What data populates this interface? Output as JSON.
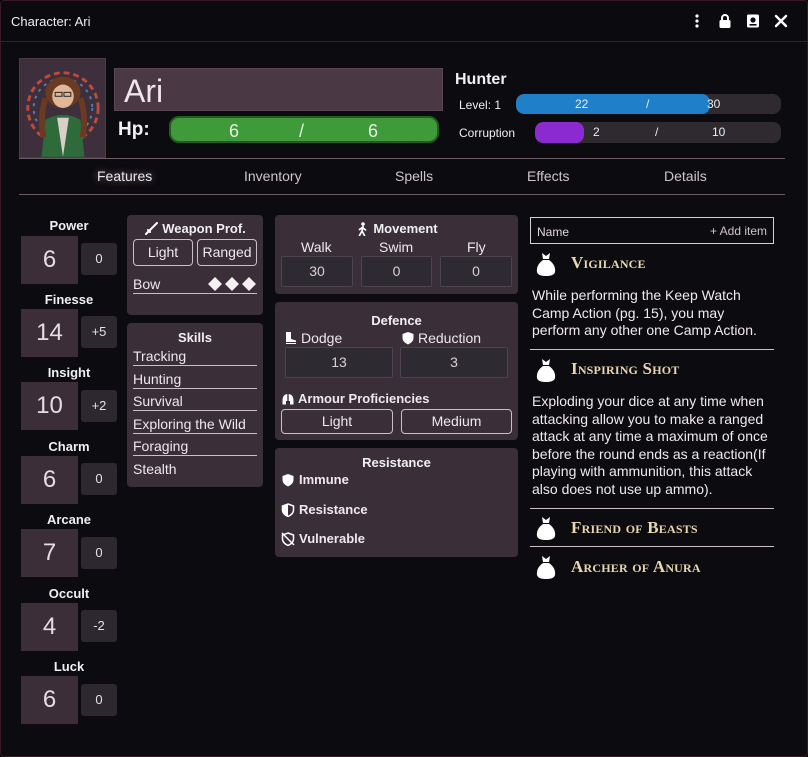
{
  "window": {
    "title": "Character: Ari"
  },
  "character": {
    "name": "Ari",
    "hp_label": "Hp:",
    "hp_current": "6",
    "hp_sep": "/",
    "hp_max": "6",
    "class": "Hunter",
    "level_label": "Level: 1",
    "xp_current": "22",
    "xp_sep": "/",
    "xp_max": "30",
    "xp_fraction": 0.733,
    "corruption_label": "Corruption",
    "corruption_current": "2",
    "corruption_sep": "/",
    "corruption_max": "10",
    "corruption_fraction": 0.2
  },
  "tabs": [
    "Features",
    "Inventory",
    "Spells",
    "Effects",
    "Details"
  ],
  "active_tab": "Features",
  "attributes": [
    {
      "label": "Power",
      "value": "6",
      "mod": "0"
    },
    {
      "label": "Finesse",
      "value": "14",
      "mod": "+5"
    },
    {
      "label": "Insight",
      "value": "10",
      "mod": "+2"
    },
    {
      "label": "Charm",
      "value": "6",
      "mod": "0"
    },
    {
      "label": "Arcane",
      "value": "7",
      "mod": "0"
    },
    {
      "label": "Occult",
      "value": "4",
      "mod": "-2"
    },
    {
      "label": "Luck",
      "value": "6",
      "mod": "0"
    }
  ],
  "weapon_prof": {
    "title": "Weapon Prof.",
    "light": "Light",
    "ranged": "Ranged",
    "bow": "Bow"
  },
  "skills": {
    "title": "Skills",
    "items": [
      "Tracking",
      "Hunting",
      "Survival",
      "Exploring the Wild",
      "Foraging",
      "Stealth"
    ]
  },
  "movement": {
    "title": "Movement",
    "walk_label": "Walk",
    "walk": "30",
    "swim_label": "Swim",
    "swim": "0",
    "fly_label": "Fly",
    "fly": "0"
  },
  "defence": {
    "title": "Defence",
    "dodge_label": "Dodge",
    "dodge": "13",
    "reduction_label": "Reduction",
    "reduction": "3",
    "armour_title": "Armour Proficiencies",
    "armour_light": "Light",
    "armour_medium": "Medium"
  },
  "resistance": {
    "title": "Resistance",
    "immune": "Immune",
    "resistance": "Resistance",
    "vulnerable": "Vulnerable"
  },
  "features_list": {
    "name_header": "Name",
    "add_item": "Add item",
    "items": [
      {
        "title": "Vigilance",
        "desc": "While performing the Keep Watch Camp Action (pg. 15), you may perform any other one Camp Action."
      },
      {
        "title": "Inspiring Shot",
        "desc": "Exploding your dice at any time when attacking allow you to make a ranged attack at any time a maximum of once before the round ends as a reaction(If playing with ammunition, this attack also does not use up ammo)."
      },
      {
        "title": "Friend of Beasts",
        "desc": ""
      },
      {
        "title": "Archer of Anura",
        "desc": ""
      }
    ]
  },
  "colors": {
    "hp_fill": "#3f9a3a",
    "xp_fill": "#1f7fc8",
    "corruption_fill": "#8a2ad0",
    "feature_title": "#e8d8b0"
  }
}
